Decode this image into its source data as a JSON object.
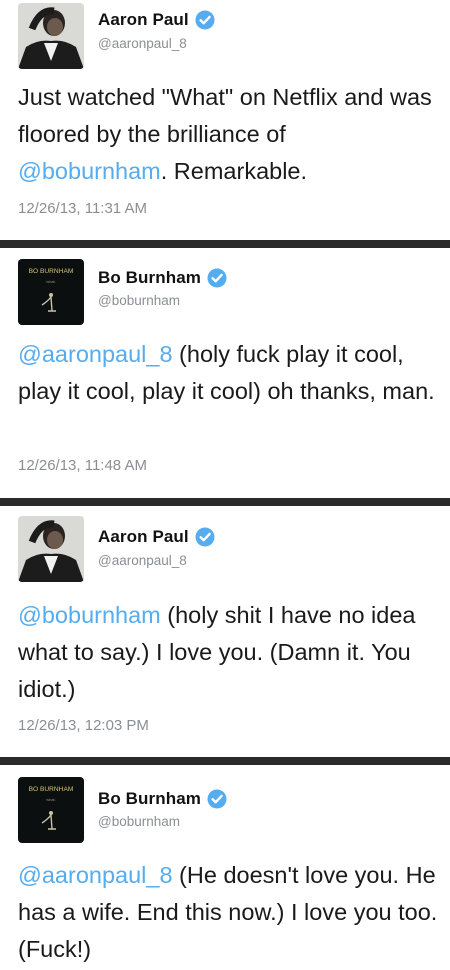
{
  "tweets": [
    {
      "author": {
        "name": "Aaron Paul",
        "handle": "@aaronpaul_8",
        "avatar": "aaron-paul-avatar"
      },
      "text_parts": [
        "Just watched \"What\" on Netflix and was floored by the brilliance of ",
        "@boburnham",
        ". Remarkable."
      ],
      "timestamp": "12/26/13, 11:31 AM"
    },
    {
      "author": {
        "name": "Bo Burnham",
        "handle": "@boburnham",
        "avatar": "bo-burnham-avatar",
        "avatar_text": "BO BURNHAM"
      },
      "text_parts": [
        "",
        "@aaronpaul_8",
        " (holy fuck play it cool, play it cool, play it cool) oh thanks, man."
      ],
      "timestamp": "12/26/13, 11:48 AM"
    },
    {
      "author": {
        "name": "Aaron Paul",
        "handle": "@aaronpaul_8",
        "avatar": "aaron-paul-avatar"
      },
      "text_parts": [
        "",
        "@boburnham",
        " (holy shit I have no idea what to say.) I love you. (Damn it. You idiot.)"
      ],
      "timestamp": "12/26/13, 12:03 PM"
    },
    {
      "author": {
        "name": "Bo Burnham",
        "handle": "@boburnham",
        "avatar": "bo-burnham-avatar",
        "avatar_text": "BO BURNHAM"
      },
      "text_parts": [
        "",
        "@aaronpaul_8",
        " (He doesn't love you. He has a wife. End this now.) I love you too. (Fuck!)"
      ],
      "timestamp": ""
    }
  ],
  "colors": {
    "mention": "#55acee",
    "verified": "#55acee",
    "divider": "#2a2a2a",
    "meta_text": "#8a8f94"
  },
  "icons": {
    "verified": "verified-badge-icon"
  }
}
